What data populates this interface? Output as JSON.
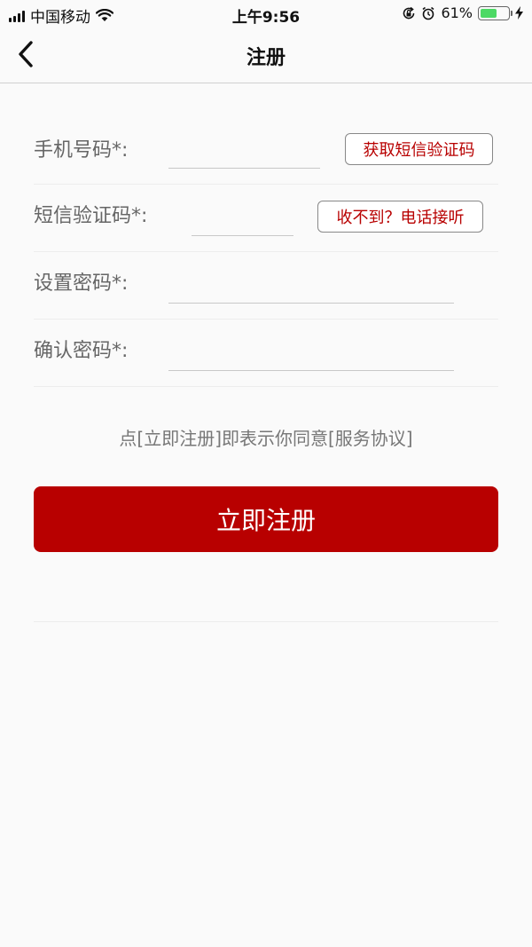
{
  "status_bar": {
    "carrier": "中国移动",
    "time": "上午9:56",
    "battery_percent": "61%",
    "battery_level": 0.61,
    "battery_color": "#4cd964",
    "icons": [
      "signal-bars-icon",
      "wifi-icon",
      "orientation-lock-icon",
      "alarm-icon",
      "battery-icon",
      "charging-bolt-icon"
    ]
  },
  "nav": {
    "title": "注册",
    "back_icon": "chevron-left-icon"
  },
  "form": {
    "phone_label": "手机号码*:",
    "phone_value": "",
    "get_code_button": "获取短信验证码",
    "code_label": "短信验证码*:",
    "code_value": "",
    "voice_code_button": "收不到？电话接听",
    "password_label": "设置密码*:",
    "password_value": "",
    "confirm_label": "确认密码*:",
    "confirm_value": ""
  },
  "agreement_text": "点[立即注册]即表示你同意[服务协议]",
  "register_button": "立即注册",
  "colors": {
    "accent": "#b80000",
    "background": "#fafafa"
  }
}
